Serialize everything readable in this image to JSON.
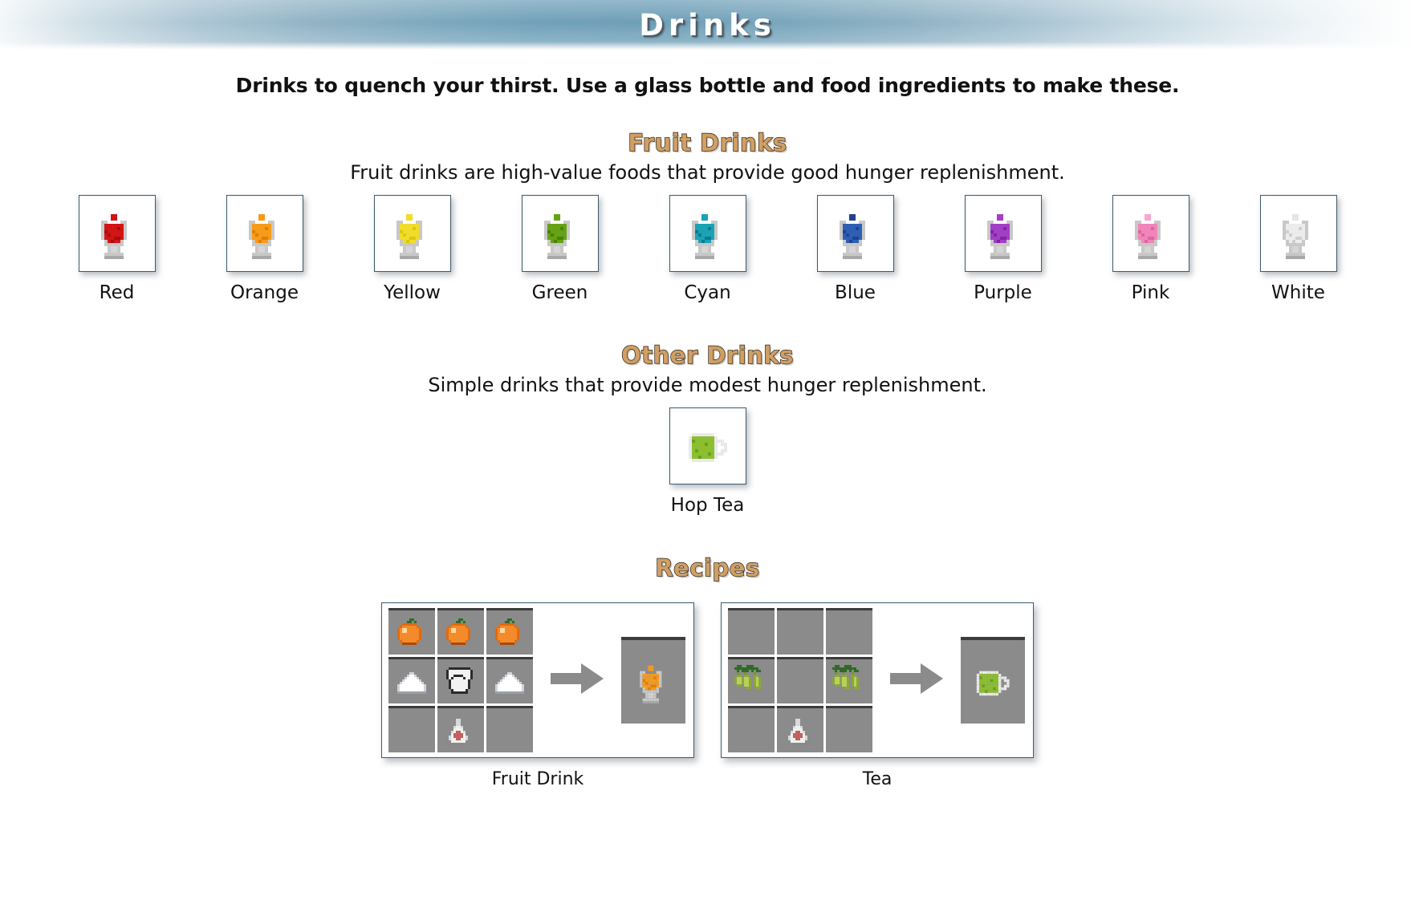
{
  "banner": {
    "title": "Drinks"
  },
  "intro": {
    "text": "Drinks to quench your thirst. Use a glass bottle and food ingredients to make these."
  },
  "sections": [
    {
      "heading": "Fruit Drinks",
      "subtitle": "Fruit drinks are high-value foods that provide good hunger replenishment.",
      "items": [
        {
          "label": "Red",
          "icon": "drink-glass-icon",
          "liquid": "#d31414",
          "liquid_dark": "#a80d0d",
          "cap": "#d31414"
        },
        {
          "label": "Orange",
          "icon": "drink-glass-icon",
          "liquid": "#f79b1a",
          "liquid_dark": "#e07f06",
          "cap": "#f79b1a"
        },
        {
          "label": "Yellow",
          "icon": "drink-glass-icon",
          "liquid": "#f0dc2a",
          "liquid_dark": "#ddc70f",
          "cap": "#f0dc2a"
        },
        {
          "label": "Green",
          "icon": "drink-glass-icon",
          "liquid": "#65a314",
          "liquid_dark": "#4d8008",
          "cap": "#65a314"
        },
        {
          "label": "Cyan",
          "icon": "drink-glass-icon",
          "liquid": "#19a3b5",
          "liquid_dark": "#0c7c8c",
          "cap": "#19a3b5"
        },
        {
          "label": "Blue",
          "icon": "drink-glass-icon",
          "liquid": "#2f5fb5",
          "liquid_dark": "#1e4490",
          "cap": "#21418f"
        },
        {
          "label": "Purple",
          "icon": "drink-glass-icon",
          "liquid": "#a23fc4",
          "liquid_dark": "#8026a3",
          "cap": "#a23fc4"
        },
        {
          "label": "Pink",
          "icon": "drink-glass-icon",
          "liquid": "#f185ba",
          "liquid_dark": "#da66a2",
          "cap": "#f6a7cf"
        },
        {
          "label": "White",
          "icon": "drink-glass-icon",
          "liquid": "#ececec",
          "liquid_dark": "#cfcfcf",
          "cap": "#e6e6e6"
        }
      ]
    },
    {
      "heading": "Other Drinks",
      "subtitle": "Simple drinks that provide modest hunger replenishment.",
      "items": [
        {
          "label": "Hop Tea",
          "icon": "tea-mug-icon",
          "liquid": "#8cbf2f",
          "liquid_dark": "#6f9c1f",
          "cap": "#e8e8e8"
        }
      ]
    }
  ],
  "recipes_heading": "Recipes",
  "recipes": [
    {
      "label": "Fruit Drink",
      "grid": [
        [
          "orange-icon",
          "orange-icon",
          "orange-icon"
        ],
        [
          "sugar-icon",
          "milk-bucket-icon",
          "sugar-icon"
        ],
        [
          "empty",
          "glass-bottle-icon",
          "empty"
        ]
      ],
      "arrow": "arrow-right-icon",
      "result": "orange-drink-icon"
    },
    {
      "label": "Tea",
      "grid": [
        [
          "empty",
          "empty",
          "empty"
        ],
        [
          "hops-icon",
          "empty",
          "hops-icon"
        ],
        [
          "empty",
          "glass-bottle-icon",
          "empty"
        ]
      ],
      "arrow": "arrow-right-icon",
      "result": "hop-tea-icon"
    }
  ],
  "colors": {
    "heading_accent": "#cf9f64",
    "heading_outline": "#2a2118",
    "box_border": "#3b5a6e",
    "cell_bg": "#8b8b8b",
    "cell_top": "#3c3c3c",
    "arrow": "#8b8b8b",
    "banner_mid": "#6d9fb8"
  }
}
